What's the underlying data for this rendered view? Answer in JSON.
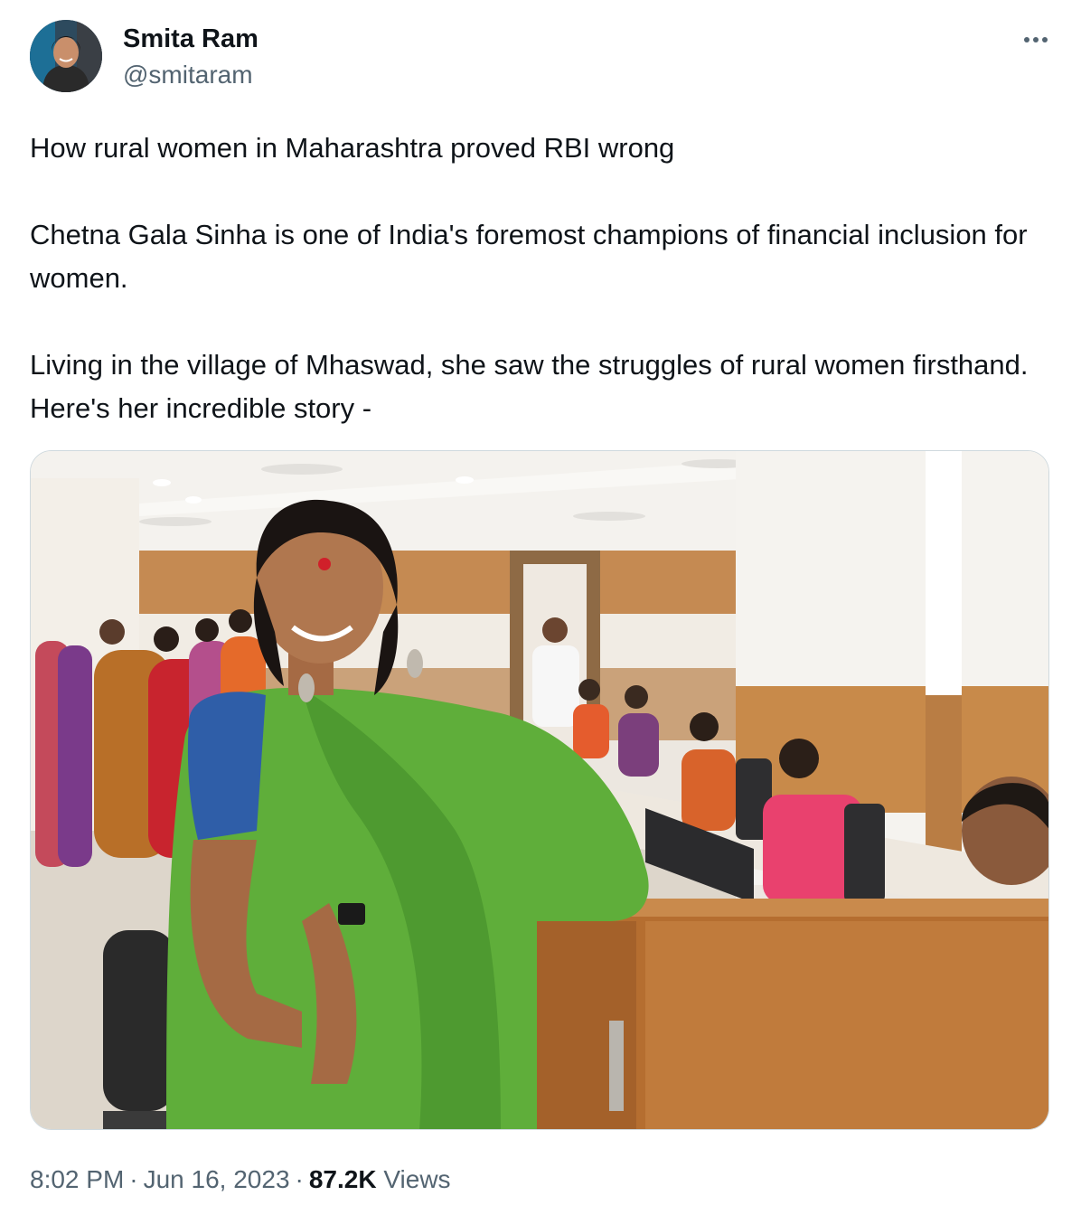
{
  "author": {
    "name": "Smita Ram",
    "handle": "@smitaram"
  },
  "tweet": {
    "paragraphs": [
      "How rural women in Maharashtra proved RBI wrong",
      "Chetna Gala Sinha is one of India's foremost champions of financial inclusion for women.",
      "Living in the village of Mhaswad, she saw the struggles of rural women firsthand. Here's her incredible story -"
    ]
  },
  "meta": {
    "time": "8:02 PM",
    "separator": "·",
    "date": "Jun 16, 2023",
    "views_count": "87.2K",
    "views_label": "Views"
  },
  "icons": {
    "more": "more-horizontal-icon"
  },
  "colors": {
    "text_primary": "#0f1419",
    "text_secondary": "#536471",
    "border": "#cfd9de",
    "saree_green": "#5fae3a"
  }
}
